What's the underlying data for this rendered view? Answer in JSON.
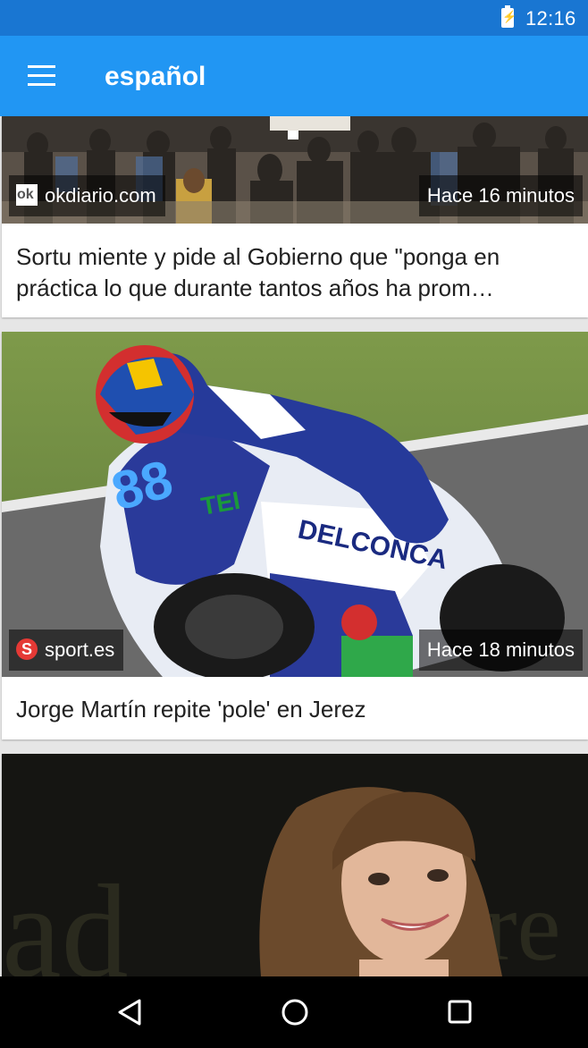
{
  "status_bar": {
    "time": "12:16",
    "icons": [
      "battery-charging-icon"
    ],
    "color": "#1976d2"
  },
  "app_bar": {
    "title": "español",
    "menu_icon": "menu-icon",
    "color": "#2196f3"
  },
  "articles": [
    {
      "source": "okdiario.com",
      "source_logo_text": "ok",
      "time": "Hace 16 minutos",
      "headline": "Sortu miente y pide al Gobierno que \"ponga en práctica lo que durante tantos años ha prom…"
    },
    {
      "source": "sport.es",
      "source_logo_text": "S",
      "time": "Hace 18 minutos",
      "headline": "Jorge Martín repite 'pole' en Jerez"
    },
    {
      "source": "",
      "time": "",
      "headline": ""
    }
  ],
  "nav_bar": {
    "buttons": [
      "back-icon",
      "home-icon",
      "recents-icon"
    ]
  }
}
